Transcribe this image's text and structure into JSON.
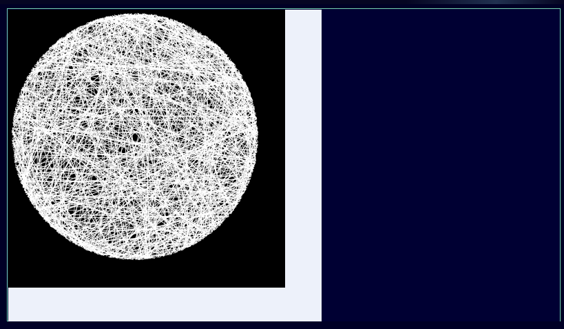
{
  "app": {
    "title": "",
    "colors": {
      "page_background": "#000026",
      "window_background": "#000033",
      "window_border": "#78d6b4",
      "left_panel_background": "#edf1fa",
      "canvas_background": "#000000",
      "line_color": "#ffffff",
      "top_strip_background": "#050522",
      "top_strip_highlight": "#20304f"
    }
  },
  "visual": {
    "primary_icon": "string-art-circle-icon",
    "description_visible": false,
    "line_count_hint": 650
  }
}
